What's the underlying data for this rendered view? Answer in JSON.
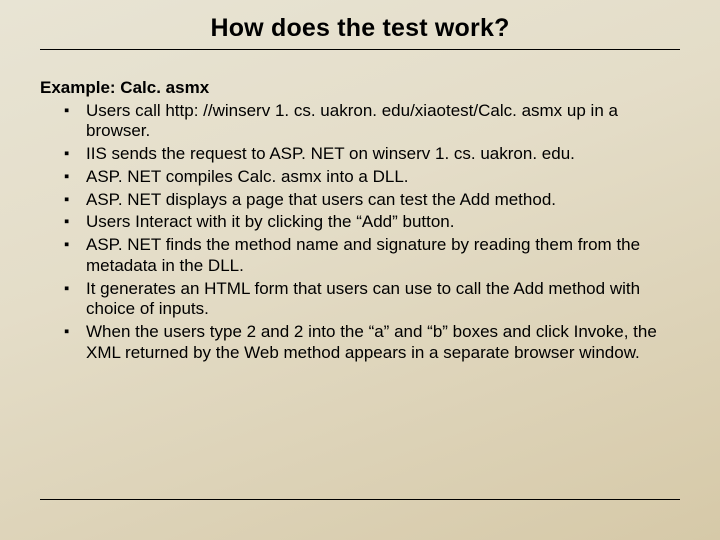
{
  "title": "How does the test work?",
  "example_label": "Example: Calc. asmx",
  "bullets": [
    "Users call http: //winserv 1. cs. uakron. edu/xiaotest/Calc. asmx up in a browser.",
    "IIS sends the request to ASP. NET on winserv 1. cs. uakron. edu.",
    "ASP. NET compiles Calc. asmx into a DLL.",
    "ASP. NET displays a page that users can test the Add method.",
    "Users Interact with it by clicking the “Add” button.",
    "ASP. NET finds the method name and signature by reading them from the metadata in the DLL.",
    "It generates an HTML form that users can use to call the Add method with choice of inputs.",
    "When the users type 2 and 2 into the “a” and “b” boxes and click Invoke, the XML returned by the Web method appears in a separate browser window."
  ]
}
